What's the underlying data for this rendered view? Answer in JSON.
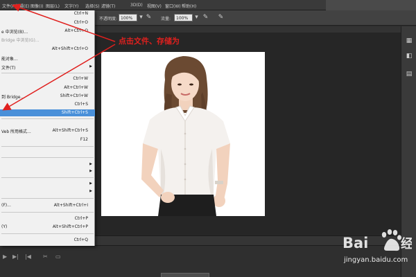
{
  "menubar": {
    "items": [
      "文件(F)",
      "编辑(E)",
      "图像(I)",
      "图层(L)",
      "文字(Y)",
      "选择(S)",
      "滤镜(T)",
      "3D(D)",
      "视图(V)",
      "窗口(W)",
      "帮助(H)"
    ]
  },
  "options": {
    "opacity_label": "不透明度:",
    "opacity_value": "100%",
    "flow_label": "流量:",
    "flow_value": "100%"
  },
  "file_menu": {
    "items": [
      {
        "label": "",
        "shortcut": "Ctrl+N"
      },
      {
        "label": "",
        "shortcut": "Ctrl+O"
      },
      {
        "label": "e 中浏览(B)...",
        "shortcut": "Alt+Ctrl+O"
      },
      {
        "label": "Bridge 中浏览(G)...",
        "shortcut": ""
      },
      {
        "label": "",
        "shortcut": "Alt+Shift+Ctrl+O"
      },
      {
        "label": "能对象...",
        "shortcut": ""
      },
      {
        "label": "文件(T)",
        "shortcut": ""
      },
      {
        "label": "",
        "shortcut": "Ctrl+W"
      },
      {
        "label": "",
        "shortcut": "Alt+Ctrl+W"
      },
      {
        "label": "到 Bridge...",
        "shortcut": "Shift+Ctrl+W"
      },
      {
        "label": "",
        "shortcut": "Ctrl+S"
      },
      {
        "label": "",
        "shortcut": "Shift+Ctrl+S"
      },
      {
        "label": "Veb 所用格式...",
        "shortcut": "Alt+Shift+Ctrl+S"
      },
      {
        "label": "",
        "shortcut": "F12"
      },
      {
        "label": "(F)...",
        "shortcut": "Alt+Shift+Ctrl+I"
      },
      {
        "label": "",
        "shortcut": "Ctrl+P"
      },
      {
        "label": "(Y)",
        "shortcut": "Alt+Shift+Ctrl+P"
      },
      {
        "label": "",
        "shortcut": "Ctrl+Q"
      }
    ]
  },
  "annotation": {
    "text": "点击文件、存储为"
  },
  "watermark": {
    "url": "jingyan.baidu.com"
  },
  "colors": {
    "highlight": "#4a90d9",
    "annotation": "#e0201e"
  }
}
